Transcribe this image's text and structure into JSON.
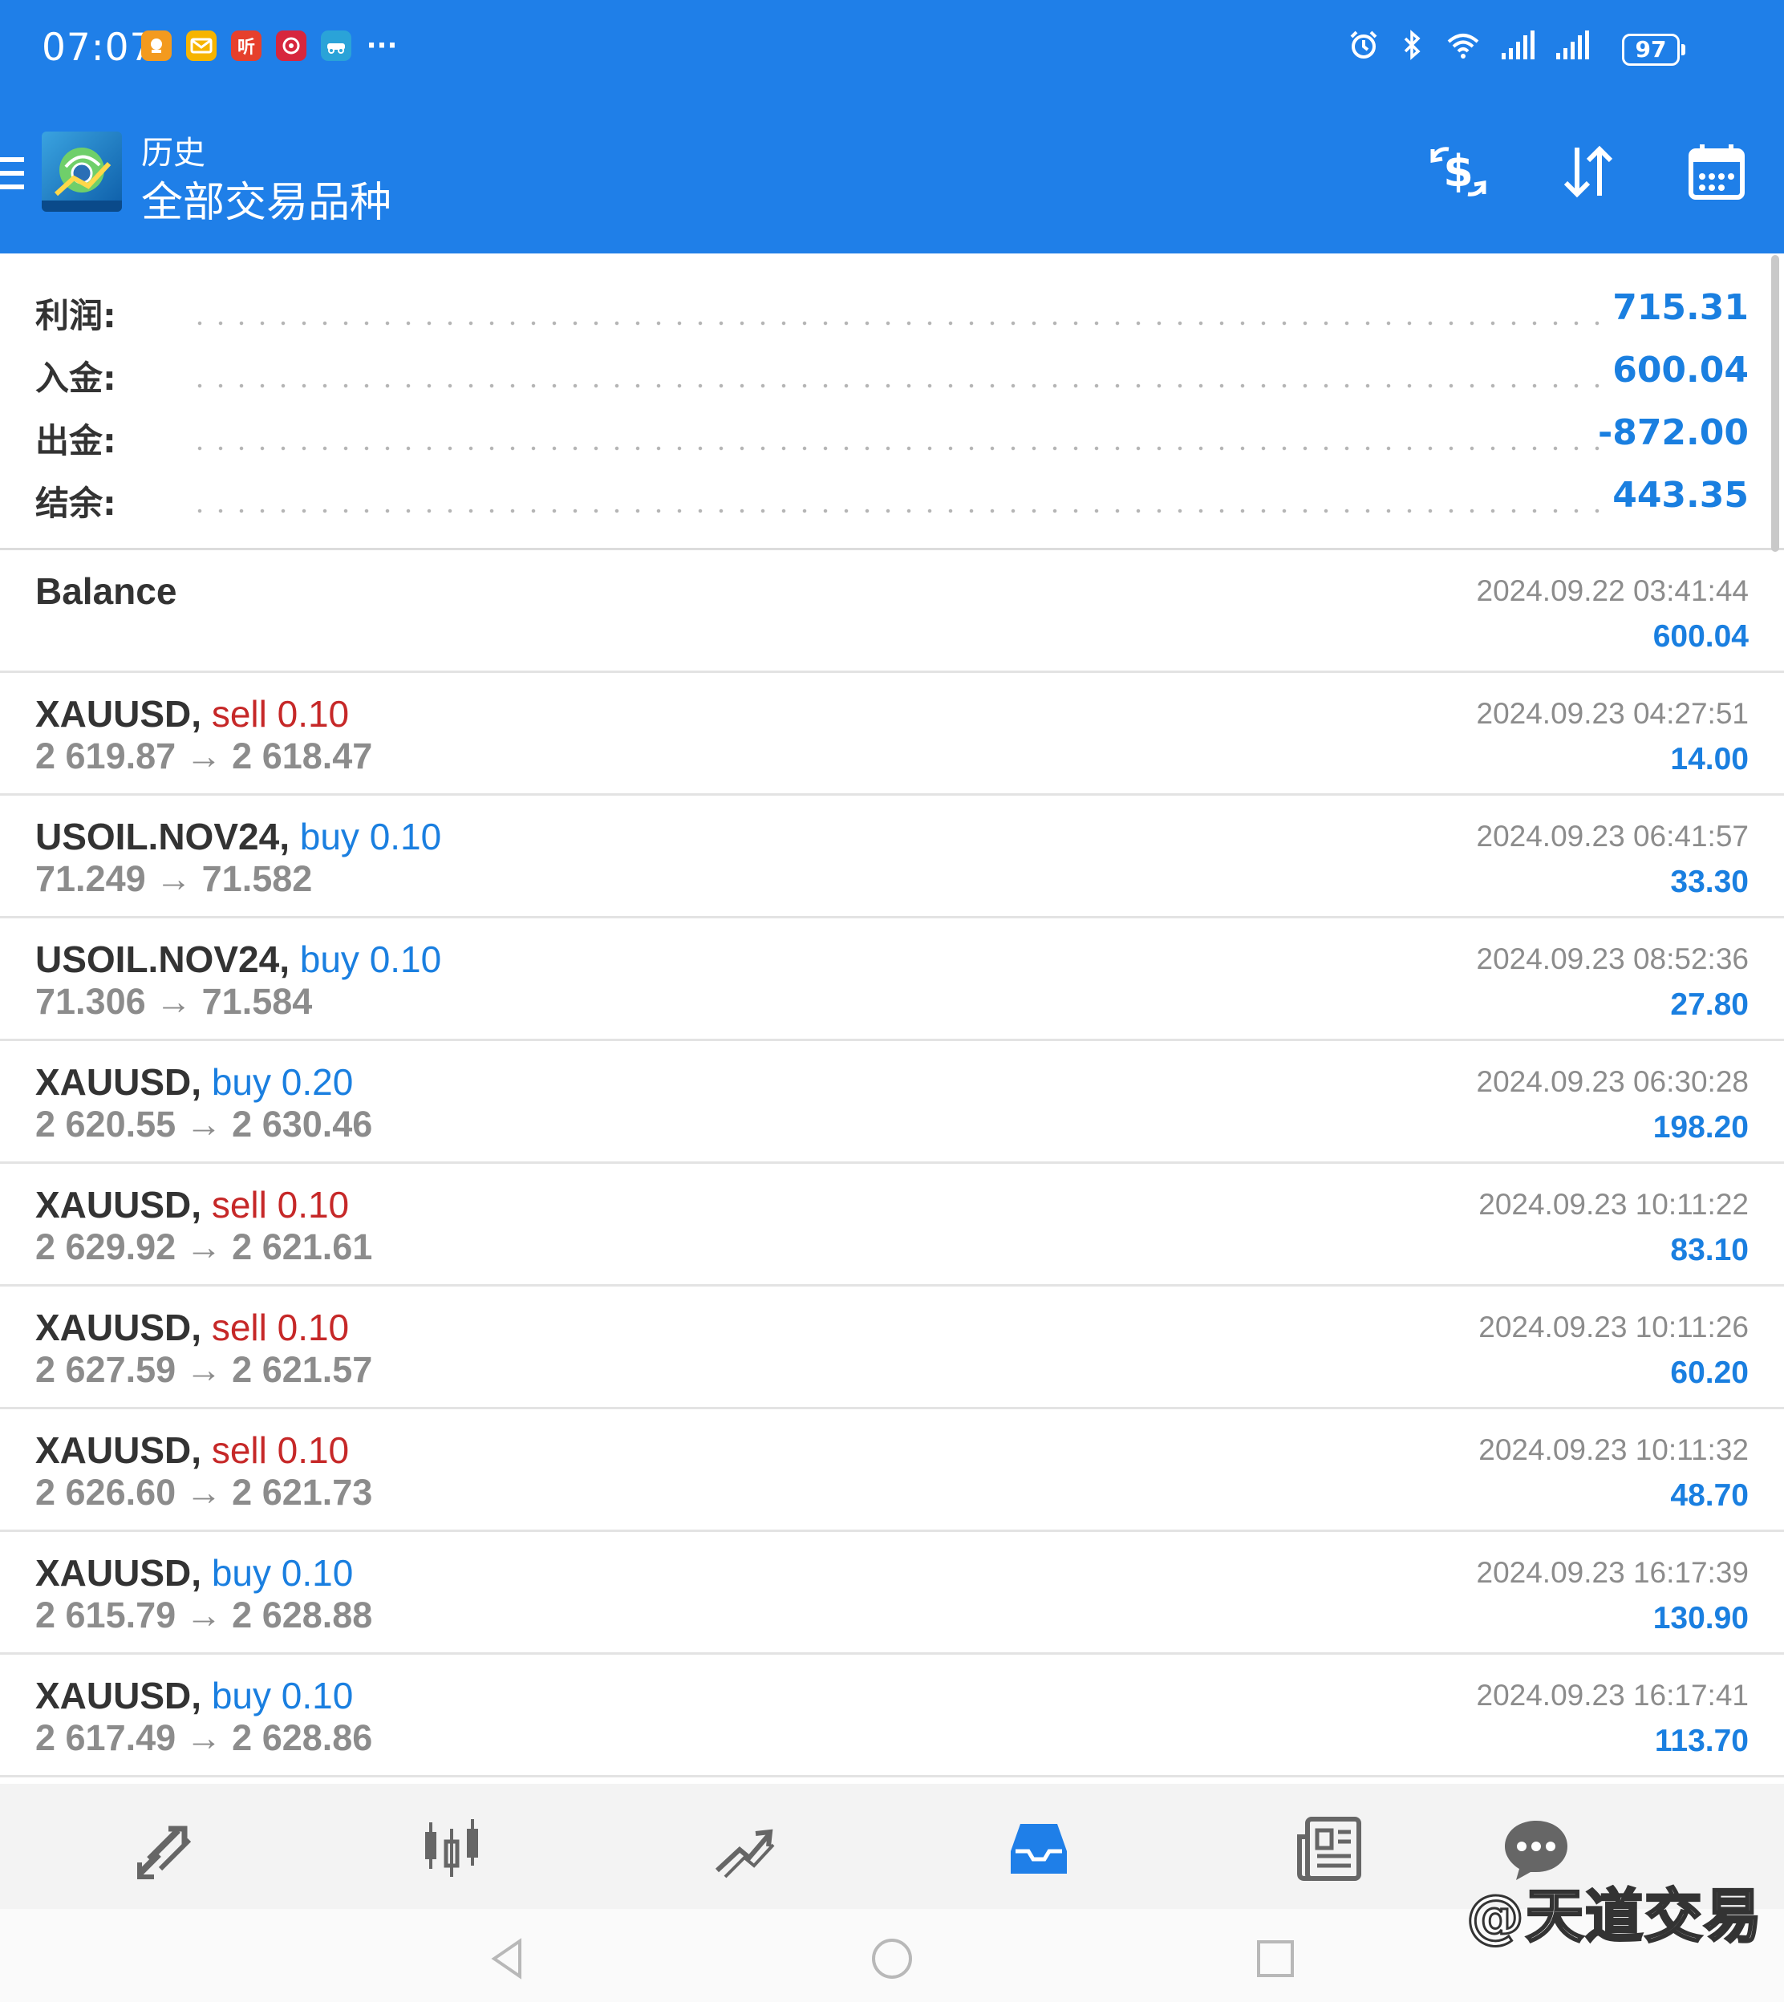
{
  "status_bar": {
    "time": "07:07",
    "notifications": [
      {
        "icon": "app-notification-orange-icon",
        "text": "",
        "color": "#f39a1e"
      },
      {
        "icon": "mail-notification-icon",
        "text": "✉",
        "color": "#f6b400"
      },
      {
        "icon": "listen-app-icon",
        "text": "听",
        "color": "#e6402c"
      },
      {
        "icon": "app-notification-red-icon",
        "text": "",
        "color": "#d7263d"
      },
      {
        "icon": "car-app-icon",
        "text": "",
        "color": "#2aa3d8"
      }
    ],
    "more": "···",
    "battery": "97"
  },
  "header": {
    "subtitle": "历史",
    "title": "全部交易品种",
    "colors": {
      "bar": "#1f7fe8"
    }
  },
  "summary": [
    {
      "label": "利润:",
      "value": "715.31"
    },
    {
      "label": "入金:",
      "value": "600.04"
    },
    {
      "label": "出金:",
      "value": "-872.00"
    },
    {
      "label": "结余:",
      "value": "443.35"
    }
  ],
  "history": [
    {
      "symbol": "Balance",
      "side": "",
      "side_class": "",
      "volume": "",
      "prices": "",
      "time": "2024.09.22 03:41:44",
      "profit": "600.04"
    },
    {
      "symbol": "XAUUSD,",
      "side": "sell 0.10",
      "side_class": "sell",
      "prices": "2 619.87 → 2 618.47",
      "time": "2024.09.23 04:27:51",
      "profit": "14.00"
    },
    {
      "symbol": "USOIL.NOV24,",
      "side": "buy 0.10",
      "side_class": "buy",
      "prices": "71.249 → 71.582",
      "time": "2024.09.23 06:41:57",
      "profit": "33.30"
    },
    {
      "symbol": "USOIL.NOV24,",
      "side": "buy 0.10",
      "side_class": "buy",
      "prices": "71.306 → 71.584",
      "time": "2024.09.23 08:52:36",
      "profit": "27.80"
    },
    {
      "symbol": "XAUUSD,",
      "side": "buy 0.20",
      "side_class": "buy",
      "prices": "2 620.55 → 2 630.46",
      "time": "2024.09.23 06:30:28",
      "profit": "198.20"
    },
    {
      "symbol": "XAUUSD,",
      "side": "sell 0.10",
      "side_class": "sell",
      "prices": "2 629.92 → 2 621.61",
      "time": "2024.09.23 10:11:22",
      "profit": "83.10"
    },
    {
      "symbol": "XAUUSD,",
      "side": "sell 0.10",
      "side_class": "sell",
      "prices": "2 627.59 → 2 621.57",
      "time": "2024.09.23 10:11:26",
      "profit": "60.20"
    },
    {
      "symbol": "XAUUSD,",
      "side": "sell 0.10",
      "side_class": "sell",
      "prices": "2 626.60 → 2 621.73",
      "time": "2024.09.23 10:11:32",
      "profit": "48.70"
    },
    {
      "symbol": "XAUUSD,",
      "side": "buy 0.10",
      "side_class": "buy",
      "prices": "2 615.79 → 2 628.88",
      "time": "2024.09.23 16:17:39",
      "profit": "130.90"
    },
    {
      "symbol": "XAUUSD,",
      "side": "buy 0.10",
      "side_class": "buy",
      "prices": "2 617.49 → 2 628.86",
      "time": "2024.09.23 16:17:41",
      "profit": "113.70"
    }
  ],
  "colors": {
    "sell": "#c62828",
    "buy": "#1a7fe0",
    "value": "#1a7fe0",
    "muted": "#8c8c8c"
  },
  "bottom_nav": [
    {
      "icon": "quotes-icon",
      "active": false
    },
    {
      "icon": "chart-candles-icon",
      "active": false
    },
    {
      "icon": "trade-icon",
      "active": false
    },
    {
      "icon": "history-inbox-icon",
      "active": true
    },
    {
      "icon": "news-icon",
      "active": false
    },
    {
      "icon": "chat-icon",
      "active": false
    }
  ],
  "watermark": "@天道交易"
}
